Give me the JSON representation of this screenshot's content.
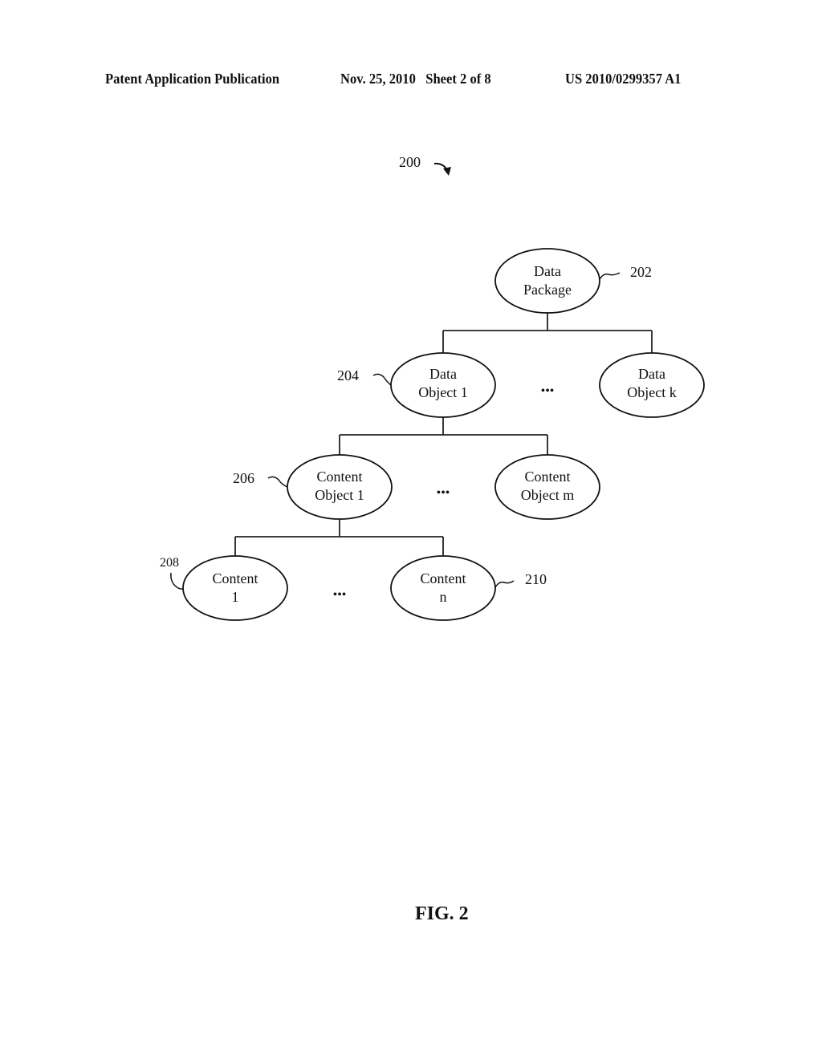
{
  "header": {
    "publication_type": "Patent Application Publication",
    "date_sheet": "Nov. 25, 2010   Sheet 2 of 8",
    "patent_number": "US 2010/0299357 A1"
  },
  "figure": {
    "ref_number": "200",
    "caption": "FIG. 2",
    "nodes": {
      "data_package": {
        "line1": "Data",
        "line2": "Package",
        "ref": "202"
      },
      "data_object_1": {
        "line1": "Data",
        "line2": "Object 1",
        "ref": "204"
      },
      "data_object_k": {
        "line1": "Data",
        "line2": "Object k"
      },
      "content_object_1": {
        "line1": "Content",
        "line2": "Object 1",
        "ref": "206"
      },
      "content_object_m": {
        "line1": "Content",
        "line2": "Object m"
      },
      "content_1": {
        "line1": "Content",
        "line2": "1",
        "ref": "208"
      },
      "content_n": {
        "line1": "Content",
        "line2": "n",
        "ref": "210"
      }
    },
    "ellipsis": "•••"
  }
}
